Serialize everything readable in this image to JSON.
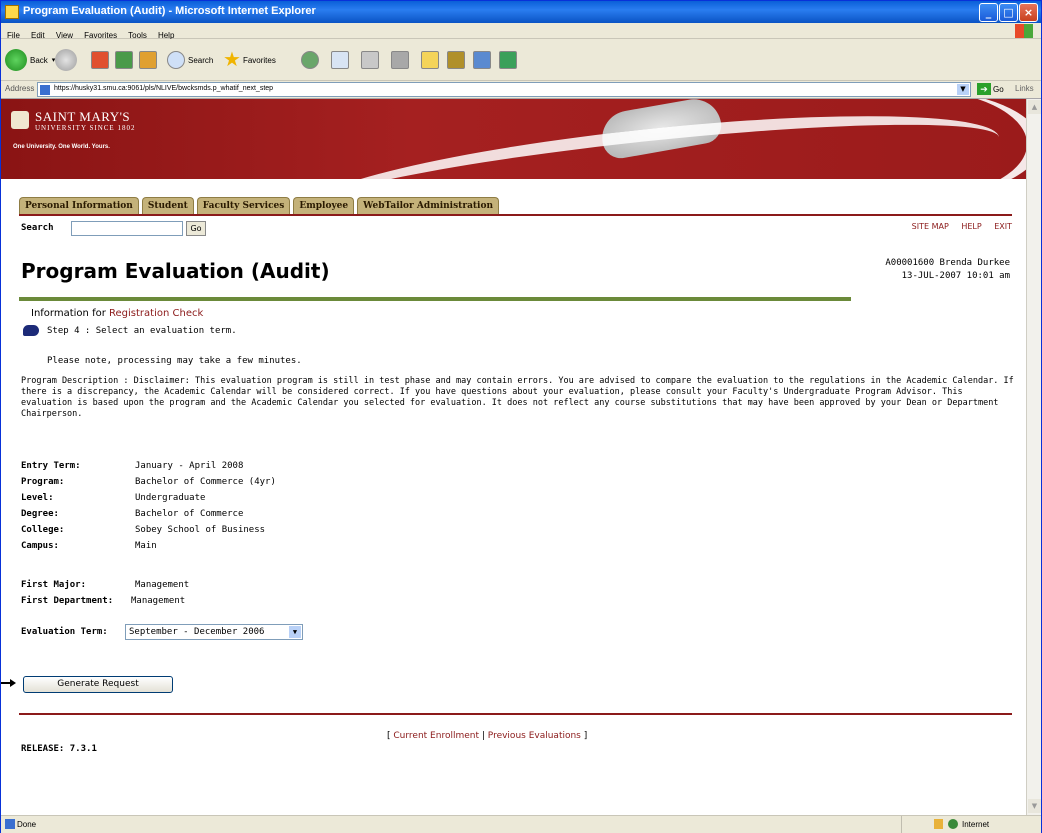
{
  "window": {
    "title": "Program Evaluation (Audit) - Microsoft Internet Explorer"
  },
  "menubar": [
    "File",
    "Edit",
    "View",
    "Favorites",
    "Tools",
    "Help"
  ],
  "toolbar": {
    "back": "Back",
    "search": "Search",
    "favorites": "Favorites"
  },
  "address": {
    "label": "Address",
    "url": "https://husky31.smu.ca:9061/pls/NLIVE/bwcksmds.p_whatif_next_step",
    "go": "Go",
    "links": "Links"
  },
  "banner": {
    "name_line1": "SAINT MARY'S",
    "name_line2": "UNIVERSITY SINCE 1802",
    "tagline": "One University. One World. Yours."
  },
  "tabs": [
    "Personal Information",
    "Student",
    "Faculty Services",
    "Employee",
    "WebTailor Administration"
  ],
  "search": {
    "label": "Search",
    "go": "Go"
  },
  "toplinks": {
    "sitemap": "SITE MAP",
    "help": "HELP",
    "exit": "EXIT"
  },
  "page": {
    "title": "Program Evaluation (Audit)",
    "user_line1": "A00001600 Brenda Durkee",
    "user_line2": "13-JUL-2007 10:01 am",
    "info_prefix": "Information for",
    "info_link": "Registration Check",
    "step": "Step 4 : Select an evaluation term.",
    "note": "Please note, processing may take a few minutes.",
    "description": "Program Description : Disclaimer: This evaluation program is still in test phase and may contain errors. You are advised to compare the evaluation to the regulations in the Academic Calendar. If there is a discrepancy, the Academic Calendar will be considered correct. If you have questions about your evaluation, please consult your Faculty's Undergraduate Program Advisor. This evaluation is based upon the program and the Academic Calendar you selected for evaluation. It does not reflect any course substitutions that may have been approved by your Dean or Department Chairperson."
  },
  "details": [
    {
      "label": "Entry Term:",
      "value": "January - April 2008"
    },
    {
      "label": "Program:",
      "value": "Bachelor of Commerce (4yr)"
    },
    {
      "label": "Level:",
      "value": "Undergraduate"
    },
    {
      "label": "Degree:",
      "value": "Bachelor of Commerce"
    },
    {
      "label": "College:",
      "value": "Sobey School of Business"
    },
    {
      "label": "Campus:",
      "value": "Main"
    }
  ],
  "majors": [
    {
      "label": "First Major:",
      "value": "Management"
    },
    {
      "label": "First Department:",
      "value": "Management"
    }
  ],
  "evaluation": {
    "label": "Evaluation Term:",
    "selected": "September - December 2006"
  },
  "generate_button": "Generate Request",
  "bottom": {
    "open": "[",
    "current": "Current Enrollment",
    "sep": "|",
    "previous": "Previous Evaluations",
    "close": "]"
  },
  "release": "RELEASE: 7.3.1",
  "status": {
    "left": "Done",
    "zone": "Internet"
  }
}
